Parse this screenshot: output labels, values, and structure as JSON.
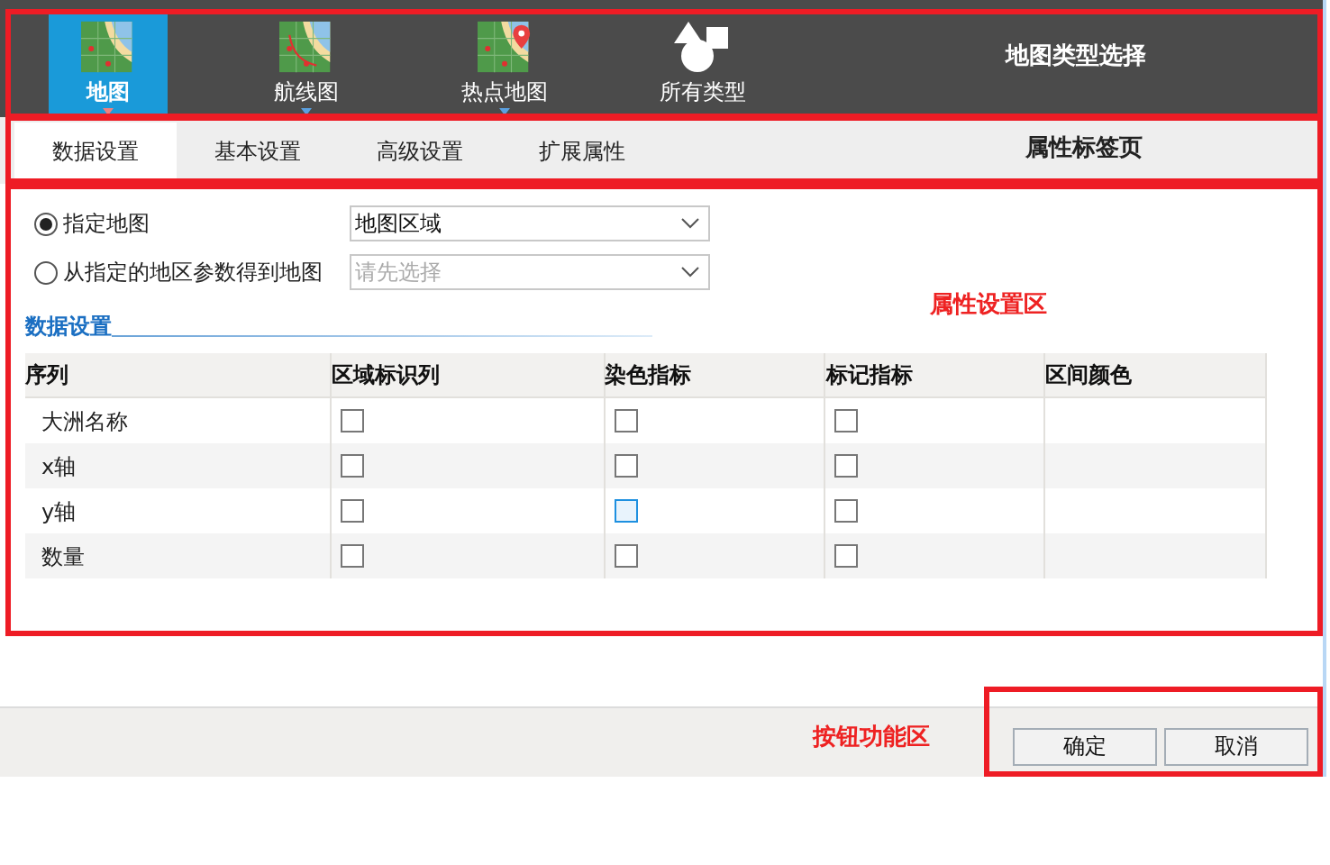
{
  "map_types": [
    {
      "label": "地图",
      "kind": "map",
      "selected": true,
      "has_menu": true
    },
    {
      "label": "航线图",
      "kind": "route",
      "selected": false,
      "has_menu": true
    },
    {
      "label": "热点地图",
      "kind": "hotspot",
      "selected": false,
      "has_menu": true
    },
    {
      "label": "所有类型",
      "kind": "shapes",
      "selected": false,
      "has_menu": false
    }
  ],
  "tabs": [
    {
      "label": "数据设置",
      "selected": true
    },
    {
      "label": "基本设置",
      "selected": false
    },
    {
      "label": "高级设置",
      "selected": false
    },
    {
      "label": "扩展属性",
      "selected": false
    }
  ],
  "source_options": [
    {
      "label": "指定地图",
      "selected": true,
      "dropdown": {
        "value": "地图区域"
      }
    },
    {
      "label": "从指定的地区参数得到地图",
      "selected": false,
      "dropdown": {
        "placeholder": "请先选择"
      }
    }
  ],
  "section_title": "数据设置",
  "table": {
    "columns": [
      "序列",
      "区域标识列",
      "染色指标",
      "标记指标",
      "区间颜色"
    ],
    "rows": [
      {
        "series": "大洲名称",
        "checks": [
          {
            "checked": false,
            "focused": false
          },
          {
            "checked": false,
            "focused": false
          },
          {
            "checked": false,
            "focused": false
          }
        ]
      },
      {
        "series": "x轴",
        "checks": [
          {
            "checked": false,
            "focused": false
          },
          {
            "checked": false,
            "focused": false
          },
          {
            "checked": false,
            "focused": false
          }
        ]
      },
      {
        "series": "y轴",
        "checks": [
          {
            "checked": false,
            "focused": false
          },
          {
            "checked": false,
            "focused": true
          },
          {
            "checked": false,
            "focused": false
          }
        ]
      },
      {
        "series": "数量",
        "checks": [
          {
            "checked": false,
            "focused": false
          },
          {
            "checked": false,
            "focused": false
          },
          {
            "checked": false,
            "focused": false
          }
        ]
      }
    ]
  },
  "buttons": [
    "确定",
    "取消"
  ],
  "annotations": {
    "toolbar": "地图类型选择",
    "tabs": "属性标签页",
    "settings": "属性设置区",
    "footer": "按钮功能区"
  }
}
